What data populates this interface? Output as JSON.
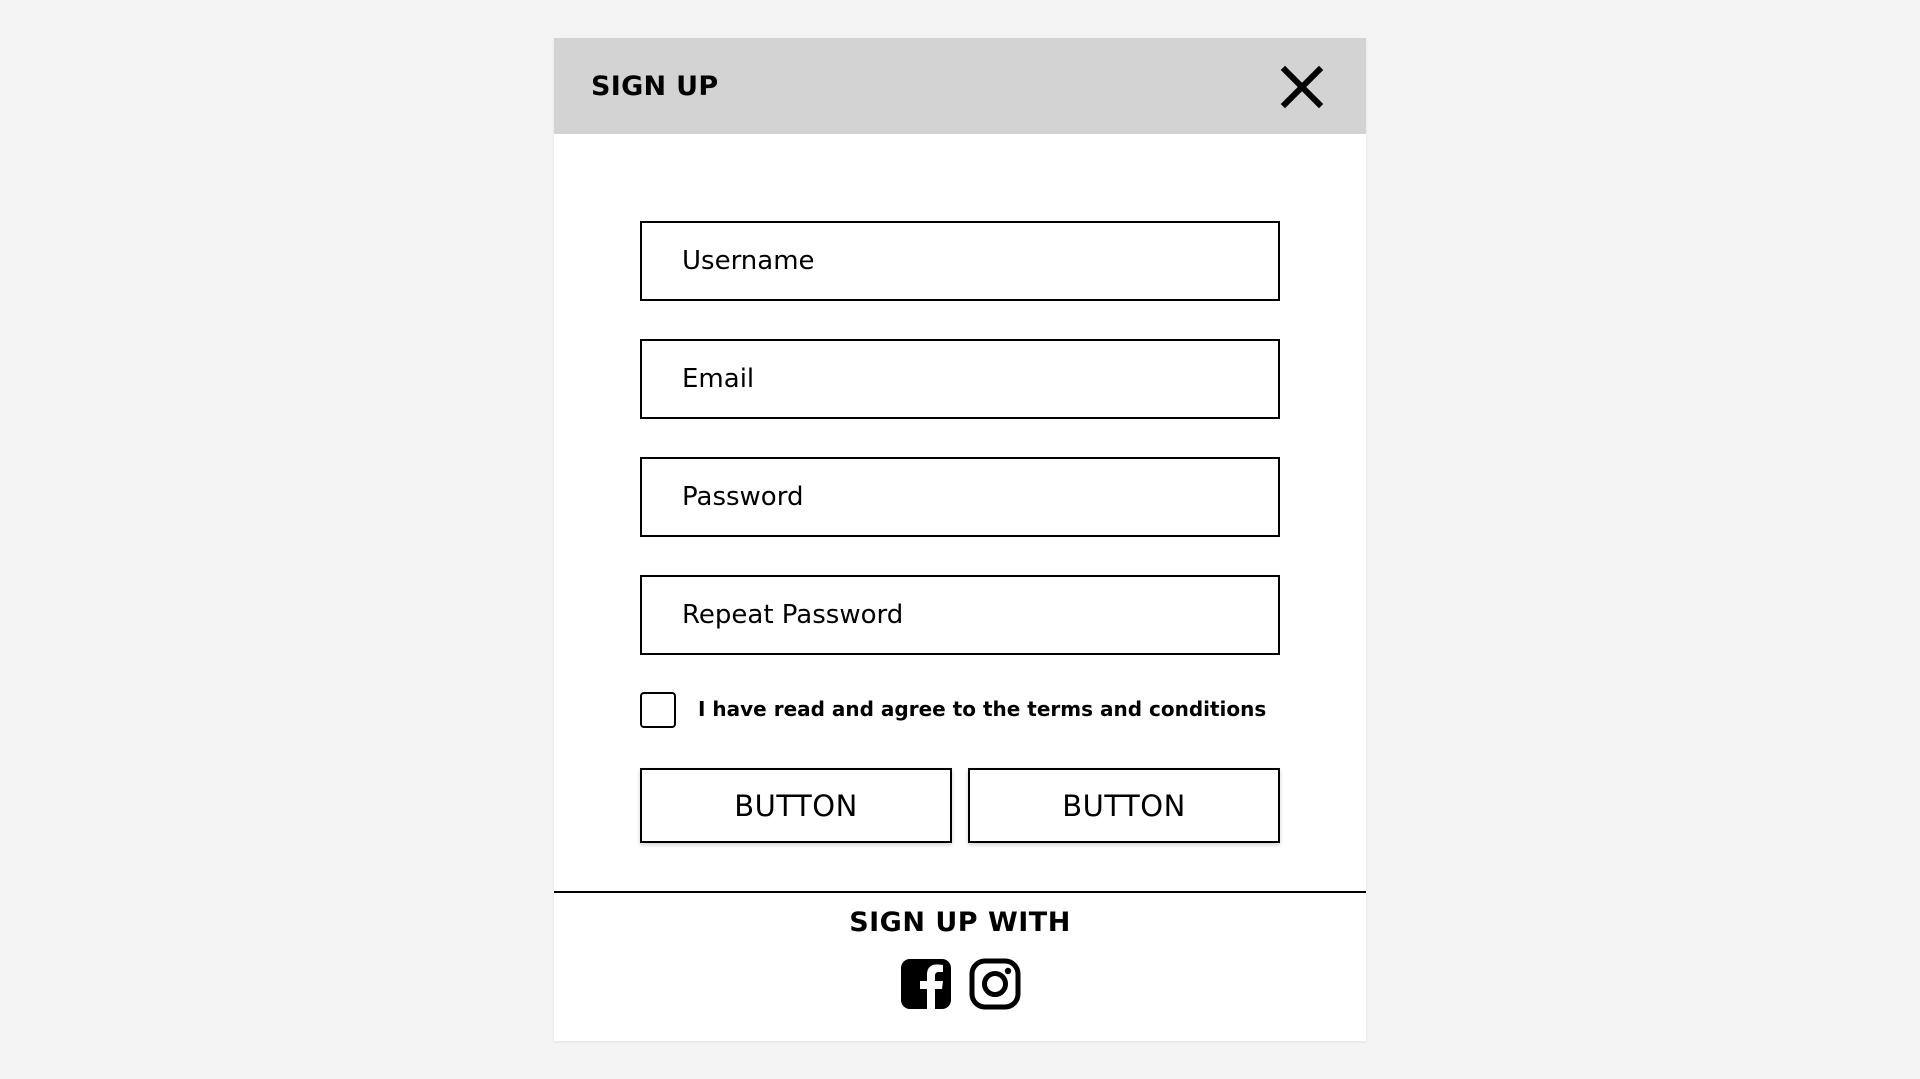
{
  "modal": {
    "title": "SIGN UP"
  },
  "form": {
    "username_placeholder": "Username",
    "email_placeholder": "Email",
    "password_placeholder": "Password",
    "repeat_password_placeholder": "Repeat Password",
    "terms_label": "I have read and agree to the terms and conditions",
    "terms_checked": false
  },
  "buttons": {
    "primary_label": "BUTTON",
    "secondary_label": "BUTTON"
  },
  "social": {
    "heading": "SIGN UP WITH",
    "icons": [
      "facebook-icon",
      "instagram-icon"
    ]
  },
  "colors": {
    "background": "#f4f4f4",
    "header": "#d3d3d3",
    "modal": "#ffffff",
    "ink": "#000000"
  }
}
